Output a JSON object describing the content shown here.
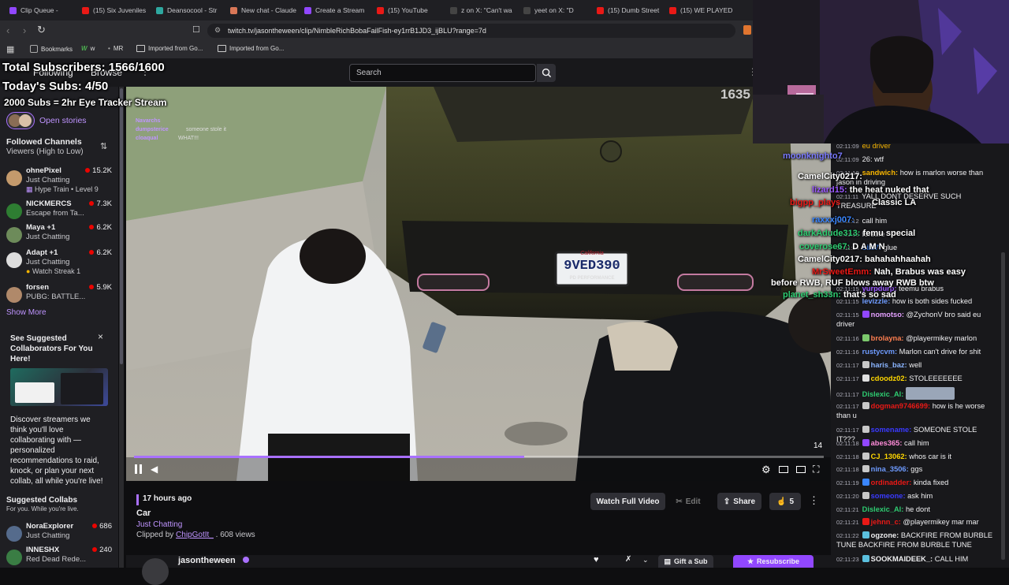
{
  "browser": {
    "tabs": [
      {
        "label": "Clip Queue -",
        "color": "#9147ff"
      },
      {
        "label": "(15) Six Juveniles",
        "color": "#e91916"
      },
      {
        "label": "Deansocool - Str",
        "color": "#2ea8a0"
      },
      {
        "label": "New chat - Claude",
        "color": "#d97757"
      },
      {
        "label": "Create a Stream",
        "color": "#9147ff"
      },
      {
        "label": "(15) YouTube",
        "color": "#e91916"
      },
      {
        "label": "z on X: \"Can't wa",
        "color": "#111111"
      },
      {
        "label": "yeet on X: \"D",
        "color": "#111111"
      },
      {
        "label": "(15) Dumb Street",
        "color": "#e91916"
      },
      {
        "label": "(15) WE PLAYED",
        "color": "#e91916"
      }
    ],
    "url": "twitch.tv/jasontheween/clip/NimbleRichBobaFailFish-ey1rrB1JD3_ijBLU?range=7d",
    "bookmarks": [
      "Bookmarks",
      "w",
      "MR",
      "Imported from Go...",
      "Imported from Go..."
    ]
  },
  "overlay": {
    "line1": "Total Subscribers: 1566/1600",
    "line2": "Today's Subs: 4/50",
    "line3": "2000 Subs = 2hr Eye Tracker Stream"
  },
  "nav": {
    "following": "Following",
    "browse": "Browse",
    "search_placeholder": "Search"
  },
  "sidebar": {
    "open_stories": "Open stories",
    "followed_title": "Followed Channels",
    "followed_sort": "Viewers (High to Low)",
    "channels": [
      {
        "name": "ohnePixel",
        "game": "Just Chatting",
        "extra": "Hype Train • Level 9",
        "viewers": "15.2K",
        "color": "#c49a6c"
      },
      {
        "name": "NICKMERCS",
        "game": "Escape from Ta...",
        "extra": "",
        "viewers": "7.3K",
        "color": "#2e7d32"
      },
      {
        "name": "Maya +1",
        "game": "Just Chatting",
        "extra": "",
        "viewers": "6.2K",
        "color": "#6d8b5a"
      },
      {
        "name": "Adapt +1",
        "game": "Just Chatting",
        "extra": "Watch Streak 1",
        "viewers": "6.2K",
        "color": "#ddd"
      },
      {
        "name": "forsen",
        "game": "PUBG: BATTLE...",
        "extra": "",
        "viewers": "5.9K",
        "color": "#b0896a"
      }
    ],
    "show_more": "Show More",
    "promo_title": "See Suggested Collaborators For You Here!",
    "promo_body": "Discover streamers we think you'll love collaborating with — personalized recommendations to raid, knock, or plan your next collab, all while you're live!",
    "collabs_title": "Suggested Collabs",
    "collabs_sub": "For you. While you're live.",
    "collabs": [
      {
        "name": "NoraExplorer",
        "game": "Just Chatting",
        "viewers": "686",
        "color": "#556b8c"
      },
      {
        "name": "INNESHX",
        "game": "Red Dead Rede...",
        "viewers": "240",
        "color": "#3a7d44"
      }
    ]
  },
  "video": {
    "plate": "9VED390",
    "plate_state": "California",
    "plate_frame": "PD PERFORMANCE",
    "counter": "1635",
    "chat_in_video": [
      {
        "user": "Navarchs",
        "text": ""
      },
      {
        "user": "dumpsterice",
        "text": "someone stole it"
      },
      {
        "user": "cloaqual",
        "text": "WHAT!!!"
      }
    ],
    "side_number": "14",
    "progress": 0.566
  },
  "clip": {
    "age": "17 hours ago",
    "title": "Car",
    "category": "Just Chatting",
    "clipped_by_prefix": "Clipped by",
    "clipper": "ChipGotIt_",
    "views": ". 608 views",
    "watch_full": "Watch Full Video",
    "edit": "Edit",
    "share": "Share",
    "likes": "5",
    "channel": "jasontheween",
    "gift": "Gift a Sub",
    "resub": "Resubscribe"
  },
  "stream_chat": [
    {
      "user": "moonknighto7",
      "text": "",
      "color": "#7a7aff"
    },
    {
      "user": "CamelCity0217:",
      "text": "",
      "color": "#ffffff"
    },
    {
      "user": "lizard15:",
      "text": "the heat nuked that",
      "color": "#9b59ff"
    },
    {
      "user": "bigpp_plays",
      "text": "Classic LA",
      "color": "#e91916"
    },
    {
      "user": "raxxxj007:",
      "text": "",
      "color": "#3a86ff"
    },
    {
      "user": "darkAdude313:",
      "text": "femu special",
      "color": "#2ecc71"
    },
    {
      "user": "coverose67:",
      "text": "D A M N",
      "color": "#2ecc71"
    },
    {
      "user": "CamelCity0217:",
      "text": "bahahahhaahah",
      "color": "#ffffff"
    },
    {
      "user": "MrSweetEmm:",
      "text": "Nah, Brabus was easy",
      "color": "#e91916"
    },
    {
      "user": "",
      "text": "before RWB, RUF blows away RWB btw",
      "color": "#ffffff"
    },
    {
      "user": "planet_sh33n:",
      "text": "that's so sad",
      "color": "#2ecc71"
    }
  ],
  "chat": [
    {
      "ts": "02:11:09",
      "user": "",
      "text": "eu driver",
      "color": "#f7b500"
    },
    {
      "ts": "02:11:09",
      "user": "",
      "text": "26: wtf",
      "color": "#efeff1"
    },
    {
      "ts": "02:11:10",
      "user": "sandwich:",
      "text": "how is marlon worse than jason in driving",
      "color": "#f7b500"
    },
    {
      "ts": "02:11:11",
      "user": "",
      "text": "YALL DONT DESERVE SUCH TREASURE",
      "color": "#efeff1"
    },
    {
      "ts": "02:11:12",
      "user": "",
      "text": "call him",
      "color": "#efeff1"
    },
    {
      "ts": "02:11:13",
      "user": "",
      "text": "forsure",
      "color": "#efeff1"
    },
    {
      "ts": "02:11:14",
      "user": "oii87:",
      "text": "glue",
      "color": "#3a86ff"
    },
    {
      "ts": "02:11:15",
      "user": "yurpdurp:",
      "text": "teemu brabus",
      "color": "#9b59ff"
    },
    {
      "ts": "02:11:15",
      "user": "levizzle:",
      "text": "how is both sides fucked",
      "color": "#6e9bff"
    },
    {
      "ts": "02:11:15",
      "user": "nomotso:",
      "text": "@ZychonV bro said eu driver",
      "color": "#e4a0ff"
    },
    {
      "ts": "02:11:16",
      "user": "brolayna:",
      "text": "@playermikey marlon",
      "color": "#ff7f50"
    },
    {
      "ts": "02:11:16",
      "user": "rustycvm:",
      "text": "Marlon can't drive for shit",
      "color": "#6e9bff"
    },
    {
      "ts": "02:11:17",
      "user": "haris_baz:",
      "text": "well",
      "color": "#8ab4ff"
    },
    {
      "ts": "02:11:17",
      "user": "cdoodz02:",
      "text": "STOLEEEEEEE",
      "color": "#ffd700"
    },
    {
      "ts": "02:11:17",
      "user": "Dislexic_Al:",
      "text": "",
      "color": "#2ecc71"
    },
    {
      "ts": "02:11:17",
      "user": "dogman9746699:",
      "text": "how is he worse than u",
      "color": "#e91916"
    },
    {
      "ts": "02:11:17",
      "user": "somename:",
      "text": "SOMEONE STOLE IT???",
      "color": "#3a3aff"
    },
    {
      "ts": "02:11:18",
      "user": "abes365:",
      "text": "call him",
      "color": "#ff8cd9"
    },
    {
      "ts": "02:11:18",
      "user": "CJ_13062:",
      "text": "whos car is it",
      "color": "#ffd700"
    },
    {
      "ts": "02:11:18",
      "user": "nina_3506:",
      "text": "ggs",
      "color": "#6e9bff"
    },
    {
      "ts": "02:11:19",
      "user": "ordinadder:",
      "text": "kinda fixed",
      "color": "#e91916"
    },
    {
      "ts": "02:11:20",
      "user": "someone:",
      "text": "ask him",
      "color": "#3a3aff"
    },
    {
      "ts": "02:11:21",
      "user": "Dislexic_Al:",
      "text": "he dont",
      "color": "#2ecc71"
    },
    {
      "ts": "02:11:21",
      "user": "jehnn_c:",
      "text": "@playermikey mar mar",
      "color": "#e91916"
    },
    {
      "ts": "02:11:22",
      "user": "ogzone:",
      "text": "BACKFIRE FROM BURBLE TUNE BACKFIRE FROM BURBLE TUNE",
      "color": "#efeff1"
    },
    {
      "ts": "02:11:23",
      "user": "SOOKMAIDEEK_:",
      "text": "CALL HIM",
      "color": "#efeff1"
    }
  ]
}
